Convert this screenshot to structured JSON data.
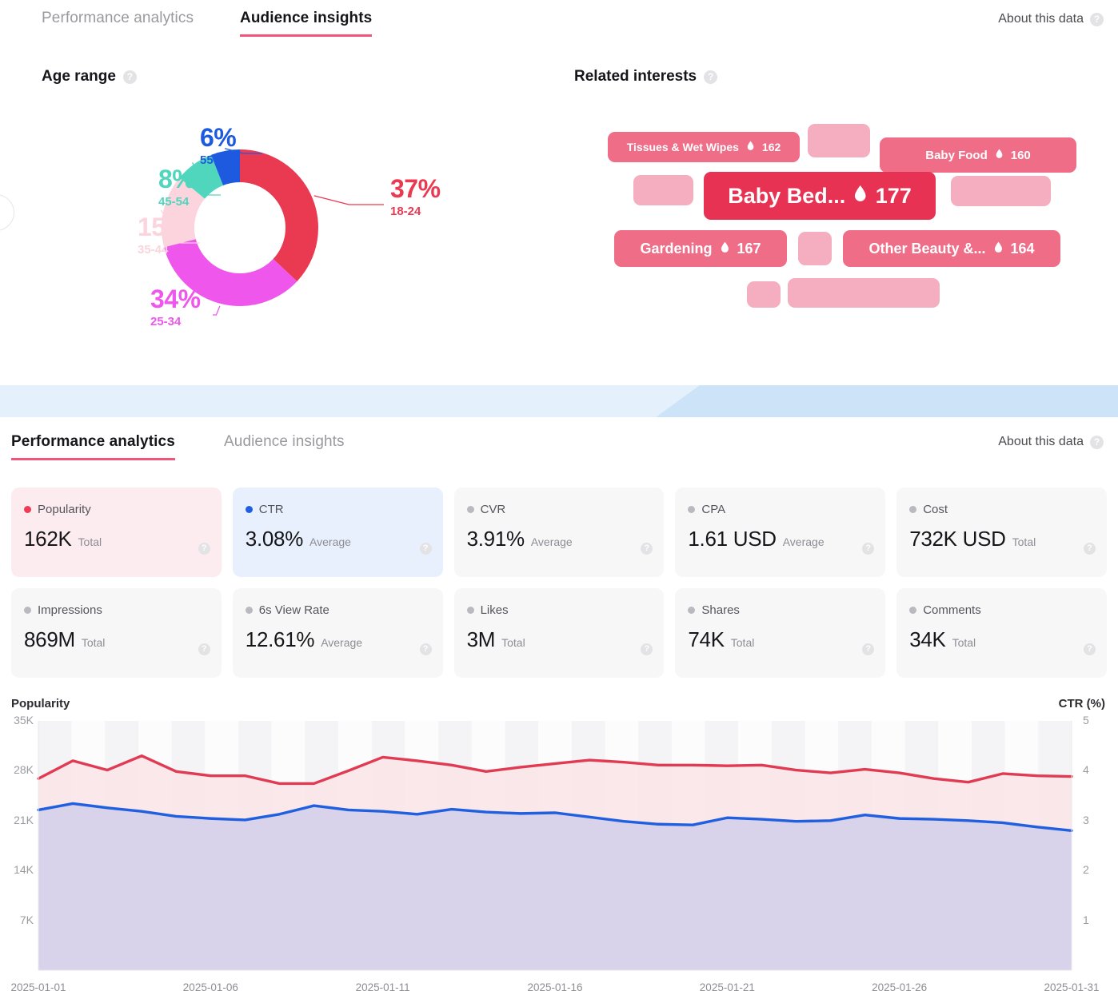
{
  "section1": {
    "tabs": [
      {
        "label": "Performance analytics",
        "active": false
      },
      {
        "label": "Audience insights",
        "active": true
      }
    ],
    "about_label": "About this data",
    "age_title": "Age range",
    "interests_title": "Related interests",
    "help_icon": "help-circle-icon",
    "age_chart": {
      "type": "pie",
      "title": "Age range",
      "categories": [
        "18-24",
        "25-34",
        "35-44",
        "45-54",
        "55+"
      ],
      "values": [
        37,
        34,
        15,
        8,
        6
      ],
      "labels": [
        "37%",
        "34%",
        "15%",
        "8%",
        "6%"
      ],
      "colors": [
        "#ea3a52",
        "#ef57ec",
        "#fbd4dd",
        "#4fd6bd",
        "#1e5ae0"
      ],
      "unit": "%",
      "donut": true
    },
    "interests": [
      {
        "label": "Tissues & Wet Wipes",
        "value": "162",
        "icon": "flame-icon",
        "color": "#ef6d86",
        "font": 14
      },
      {
        "label": "Baby Food",
        "value": "160",
        "icon": "flame-icon",
        "color": "#ef6d86",
        "font": 15
      },
      {
        "label": "Baby Bed...",
        "value": "177",
        "icon": "flame-icon",
        "color": "#e83253",
        "font": 27
      },
      {
        "label": "Gardening",
        "value": "167",
        "icon": "flame-icon",
        "color": "#ef6d86",
        "font": 18
      },
      {
        "label": "Other Beauty &...",
        "value": "164",
        "icon": "flame-icon",
        "color": "#ef6d86",
        "font": 18
      }
    ]
  },
  "section2": {
    "tabs": [
      {
        "label": "Performance analytics",
        "active": true
      },
      {
        "label": "Audience insights",
        "active": false
      }
    ],
    "about_label": "About this data",
    "metrics": [
      {
        "name": "Popularity",
        "value": "162K",
        "agg": "Total",
        "dot": "red"
      },
      {
        "name": "CTR",
        "value": "3.08%",
        "agg": "Average",
        "dot": "blue"
      },
      {
        "name": "CVR",
        "value": "3.91%",
        "agg": "Average",
        "dot": "grey"
      },
      {
        "name": "CPA",
        "value": "1.61 USD",
        "agg": "Average",
        "dot": "grey"
      },
      {
        "name": "Cost",
        "value": "732K USD",
        "agg": "Total",
        "dot": "grey"
      },
      {
        "name": "Impressions",
        "value": "869M",
        "agg": "Total",
        "dot": "grey"
      },
      {
        "name": "6s View Rate",
        "value": "12.61%",
        "agg": "Average",
        "dot": "grey"
      },
      {
        "name": "Likes",
        "value": "3M",
        "agg": "Total",
        "dot": "grey"
      },
      {
        "name": "Shares",
        "value": "74K",
        "agg": "Total",
        "dot": "grey"
      },
      {
        "name": "Comments",
        "value": "34K",
        "agg": "Total",
        "dot": "grey"
      }
    ]
  },
  "chart_data": {
    "type": "area",
    "title": "",
    "ylabel": "Popularity",
    "y2label": "CTR (%)",
    "xlabel": "",
    "ylim": [
      0,
      35000
    ],
    "y2lim": [
      0,
      5
    ],
    "yticks": [
      "7K",
      "14K",
      "21K",
      "28K",
      "35K"
    ],
    "ytick_values": [
      7000,
      14000,
      21000,
      28000,
      35000
    ],
    "y2ticks": [
      "1",
      "2",
      "3",
      "4",
      "5"
    ],
    "y2tick_values": [
      1,
      2,
      3,
      4,
      5
    ],
    "xticks": [
      "2025-01-01",
      "2025-01-06",
      "2025-01-11",
      "2025-01-16",
      "2025-01-21",
      "2025-01-26",
      "2025-01-31"
    ],
    "grid": false,
    "legend": "none",
    "x": [
      "2025-01-01",
      "2025-01-02",
      "2025-01-03",
      "2025-01-04",
      "2025-01-05",
      "2025-01-06",
      "2025-01-07",
      "2025-01-08",
      "2025-01-09",
      "2025-01-10",
      "2025-01-11",
      "2025-01-12",
      "2025-01-13",
      "2025-01-14",
      "2025-01-15",
      "2025-01-16",
      "2025-01-17",
      "2025-01-18",
      "2025-01-19",
      "2025-01-20",
      "2025-01-21",
      "2025-01-22",
      "2025-01-23",
      "2025-01-24",
      "2025-01-25",
      "2025-01-26",
      "2025-01-27",
      "2025-01-28",
      "2025-01-29",
      "2025-01-30",
      "2025-01-31"
    ],
    "series": [
      {
        "name": "Popularity",
        "axis": "left",
        "color": "#e13b53",
        "fill": "#fae4e8",
        "values": [
          26900,
          29400,
          28100,
          30100,
          27900,
          27300,
          27300,
          26200,
          26200,
          28000,
          29900,
          29400,
          28800,
          27900,
          28500,
          29000,
          29500,
          29200,
          28800,
          28800,
          28700,
          28800,
          28100,
          27700,
          28200,
          27700,
          26900,
          26400,
          27600,
          27300,
          27200
        ]
      },
      {
        "name": "CTR",
        "axis": "right",
        "color": "#1f5fe0",
        "fill": "#d6d2ea",
        "values": [
          22500,
          23400,
          22800,
          22300,
          21600,
          21300,
          21100,
          21900,
          23100,
          22500,
          22300,
          21900,
          22600,
          22200,
          22000,
          22100,
          21500,
          20900,
          20500,
          20400,
          21400,
          21200,
          20900,
          21000,
          21800,
          21300,
          21200,
          21000,
          20700,
          20100,
          19600
        ]
      }
    ]
  }
}
